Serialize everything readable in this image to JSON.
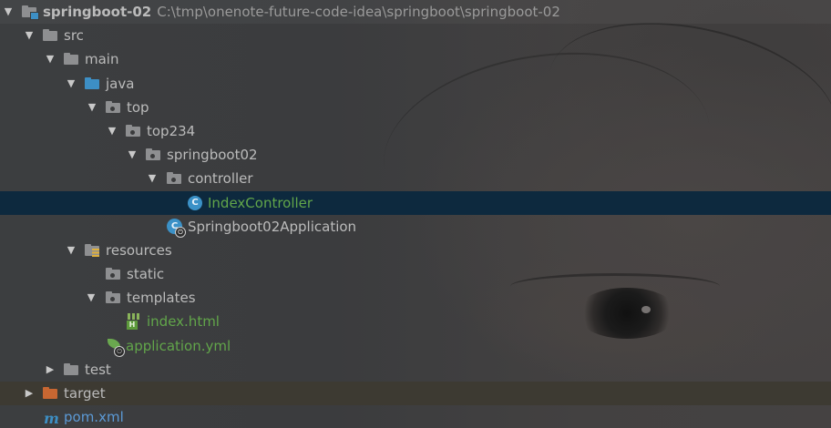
{
  "tree": {
    "root": {
      "name": "springboot-02",
      "path": "C:\\tmp\\onenote-future-code-idea\\springboot\\springboot-02"
    },
    "src": "src",
    "main": "main",
    "java": "java",
    "top": "top",
    "top234": "top234",
    "springboot02": "springboot02",
    "controller": "controller",
    "index_controller": "IndexController",
    "application_class": "Springboot02Application",
    "resources": "resources",
    "static": "static",
    "templates": "templates",
    "index_html": "index.html",
    "application_yml": "application.yml",
    "test": "test",
    "target": "target",
    "pom": "pom.xml"
  },
  "icons": {
    "class_letter": "C",
    "html_letter": "H",
    "maven_letter": "m",
    "power_symbol": "⏻"
  },
  "colors": {
    "selected_row": "#0d293e",
    "green_text": "#62a64a",
    "blue_text": "#5c9ad6",
    "folder_gray": "#8e8f91",
    "source_folder_blue": "#3d8fc5",
    "excluded_orange": "#c86732"
  }
}
